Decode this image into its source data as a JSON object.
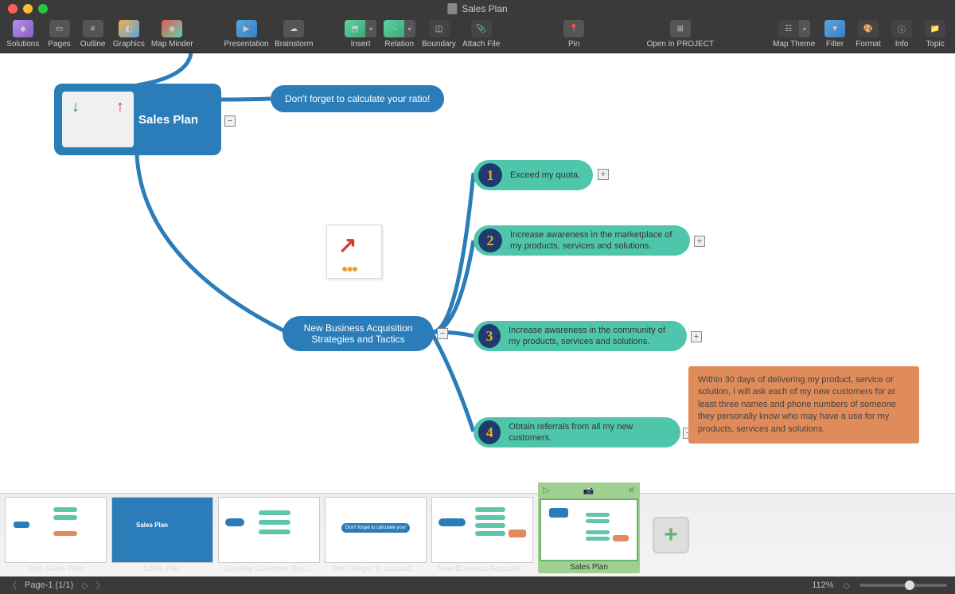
{
  "window": {
    "title": "Sales Plan"
  },
  "toolbar": {
    "solutions": "Solutions",
    "pages": "Pages",
    "outline": "Outline",
    "graphics": "Graphics",
    "map_minder": "Map Minder",
    "presentation": "Presentation",
    "brainstorm": "Brainstorm",
    "insert": "Insert",
    "relation": "Relation",
    "boundary": "Boundary",
    "attach_file": "Attach File",
    "pin": "Pin",
    "open_project": "Open in PROJECT",
    "map_theme": "Map Theme",
    "filter": "Filter",
    "format": "Format",
    "info": "Info",
    "topic": "Topic"
  },
  "map": {
    "root": "Sales Plan",
    "callout": "Don't forget to calculate your ratio!",
    "subtopic": "New Business Acquisition Strategies and Tactics",
    "leaves": [
      {
        "n": "1",
        "text": "Exceed my quota."
      },
      {
        "n": "2",
        "text": "Increase awareness in the marketplace of my products, services and solutions."
      },
      {
        "n": "3",
        "text": "Increase awareness in the community of my products, services and solutions."
      },
      {
        "n": "4",
        "text": "Obtain referrals from all my new customers."
      }
    ],
    "note": "Within 30 days of delivering my product, service or solution, I will ask each of my new customers for at least three names and phone numbers of someone they personally know who may have a use for my products, services and solutions."
  },
  "slides": [
    {
      "caption": "Map Sales Plan"
    },
    {
      "caption": "Sales Plan"
    },
    {
      "caption": "Existing Customer Bus…"
    },
    {
      "caption": "Don't forget to calculat…"
    },
    {
      "caption": "New Business Acquisiti…"
    },
    {
      "caption": "Sales Plan"
    }
  ],
  "status": {
    "page": "Page-1 (1/1)",
    "zoom": "112%"
  }
}
